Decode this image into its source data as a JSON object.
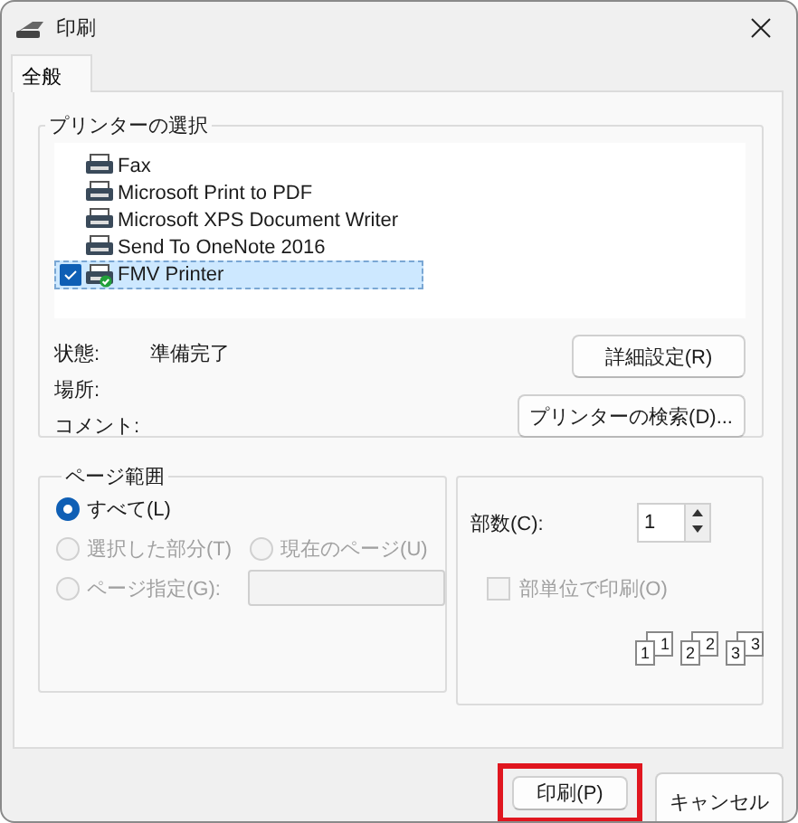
{
  "window": {
    "title": "印刷"
  },
  "tabs": [
    {
      "label": "全般",
      "selected": true
    }
  ],
  "printer_selection": {
    "title": "プリンターの選択",
    "printers": [
      {
        "name": "Fax",
        "kind": "fax",
        "selected": false
      },
      {
        "name": "Microsoft Print to PDF",
        "kind": "printer",
        "selected": false
      },
      {
        "name": "Microsoft XPS Document Writer",
        "kind": "printer",
        "selected": false
      },
      {
        "name": "Send To OneNote 2016",
        "kind": "printer",
        "selected": false
      },
      {
        "name": "FMV Printer",
        "kind": "default",
        "selected": true
      }
    ],
    "info": [
      {
        "label": "状態:",
        "value": "準備完了"
      },
      {
        "label": "場所:"
      },
      {
        "label": "コメント:"
      }
    ],
    "buttons": [
      "詳細設定(R)",
      "プリンターの検索(D)..."
    ]
  },
  "page_range": {
    "title": "ページ範囲",
    "options": [
      {
        "label": "すべて(L)",
        "selected": true,
        "disabled": false
      },
      {
        "label": "選択した部分(T)",
        "selected": false,
        "disabled": true
      },
      {
        "label": "現在のページ(U)",
        "selected": false,
        "disabled": true
      },
      {
        "label": "ページ指定(G):",
        "selected": false,
        "disabled": true
      }
    ],
    "pages_field": {
      "disabled": true
    }
  },
  "copies": {
    "label": "部数(C):",
    "value": "1",
    "collate": {
      "label": "部単位で印刷(O)",
      "checked": false,
      "disabled": true
    },
    "collate_pages": [
      "1",
      "1",
      "2",
      "2",
      "3",
      "3"
    ]
  },
  "buttons": [
    {
      "label": "印刷(P)",
      "highlighted": true
    },
    {
      "label": "キャンセル",
      "highlighted": false
    }
  ]
}
